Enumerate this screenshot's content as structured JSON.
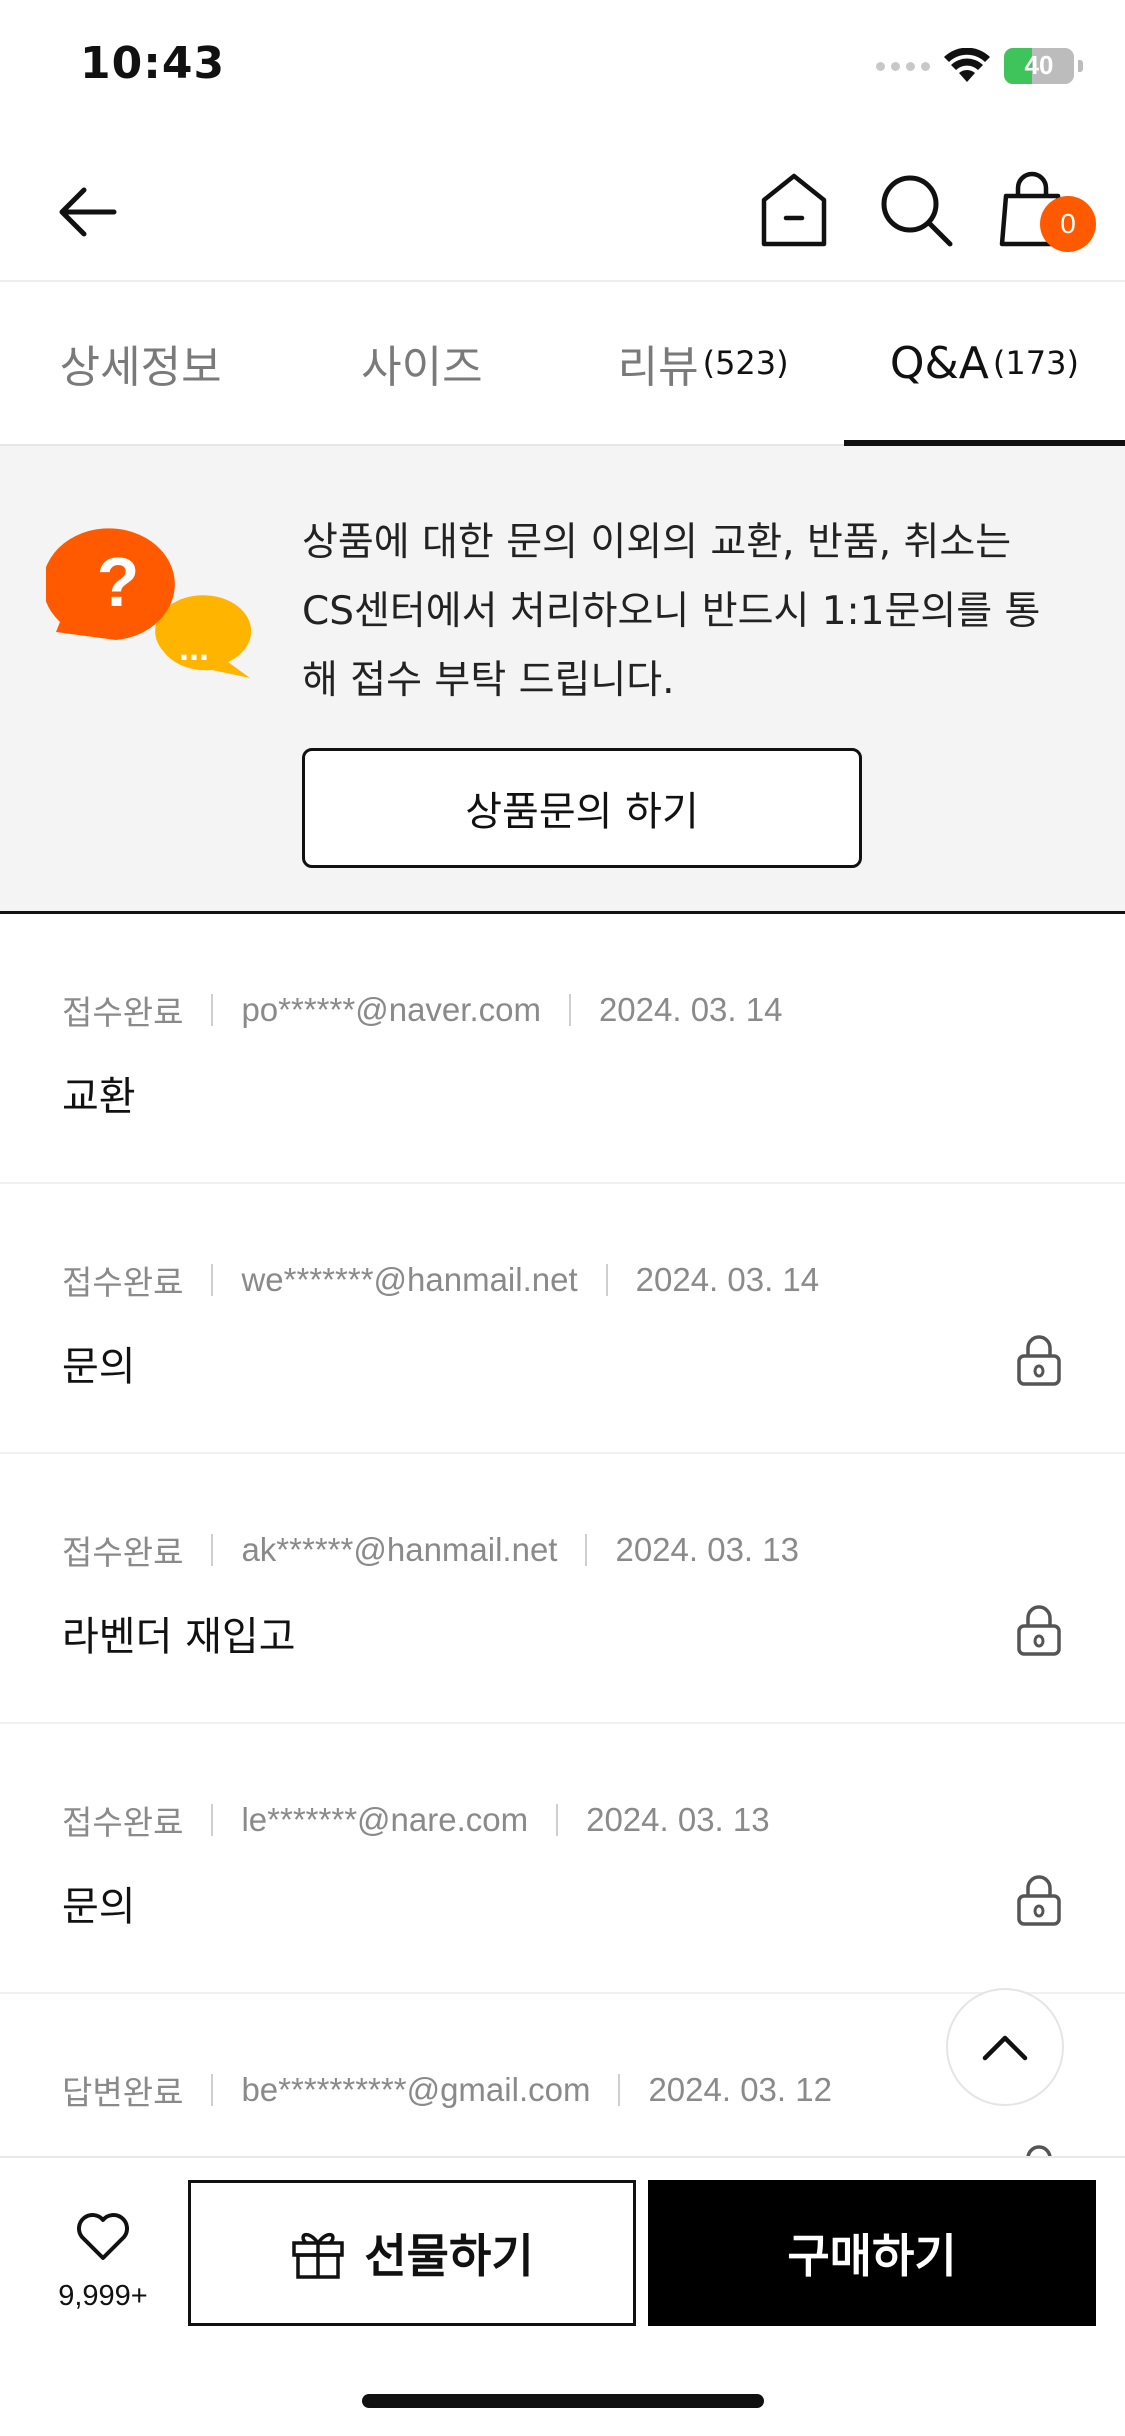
{
  "status_bar": {
    "time": "10:43",
    "battery": "40",
    "battery_fraction": 0.4,
    "accent_green": "#3ec45b"
  },
  "header": {
    "icons": [
      "back-arrow-icon",
      "home-icon",
      "search-icon",
      "shopping-bag-icon"
    ],
    "cart_count": "0",
    "badge_color": "#ff5a00"
  },
  "tabs": [
    {
      "label": "상세정보",
      "count": "",
      "active": false
    },
    {
      "label": "사이즈",
      "count": "",
      "active": false
    },
    {
      "label": "리뷰",
      "count": "(523)",
      "active": false
    },
    {
      "label": "Q&A",
      "count": "(173)",
      "active": true
    }
  ],
  "notice": {
    "text_line1": "상품에 대한 문의 이외의 교환, 반품, 취소는",
    "text_line2": "CS센터에서 처리하오니 반드시 1:1문의를 통",
    "text_line3": "해 접수 부탁 드립니다.",
    "button_label": "상품문의 하기",
    "icon_question": "?",
    "icon_dots": "..."
  },
  "qa_items": [
    {
      "status": "접수완료",
      "user": "po******@naver.com",
      "date": "2024. 03. 14",
      "title": "교환",
      "locked": false
    },
    {
      "status": "접수완료",
      "user": "we*******@hanmail.net",
      "date": "2024. 03. 14",
      "title": "문의",
      "locked": true
    },
    {
      "status": "접수완료",
      "user": "ak******@hanmail.net",
      "date": "2024. 03. 13",
      "title": "라벤더 재입고",
      "locked": true
    },
    {
      "status": "접수완료",
      "user": "le*******@nare.com",
      "date": "2024. 03. 13",
      "title": "문의",
      "locked": true
    },
    {
      "status": "답변완료",
      "user": "be**********@gmail.com",
      "date": "2024. 03. 12",
      "title": "",
      "locked": true
    }
  ],
  "bottom_bar": {
    "like_count": "9,999+",
    "gift_label": "선물하기",
    "buy_label": "구매하기"
  }
}
